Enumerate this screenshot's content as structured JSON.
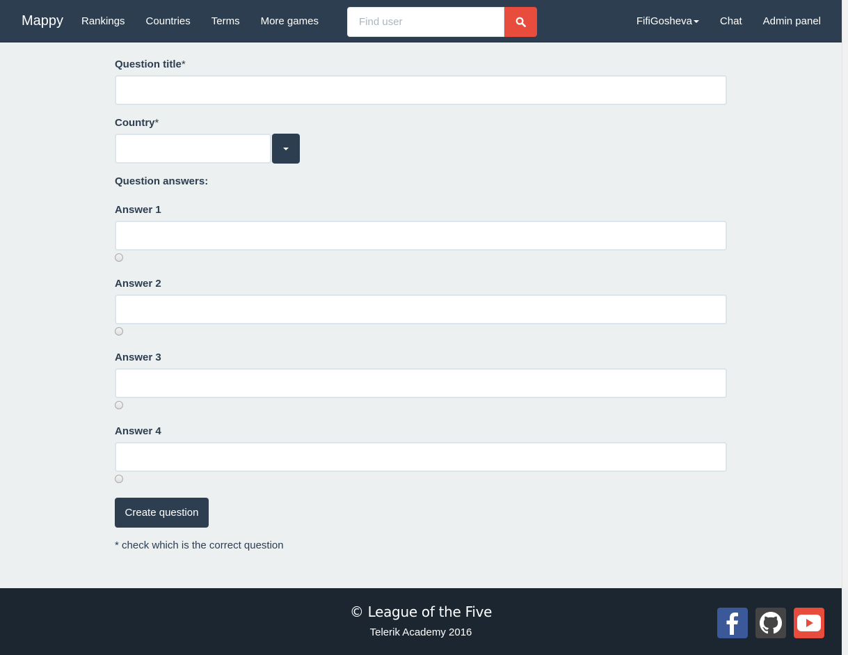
{
  "navbar": {
    "brand": "Mappy",
    "links": [
      "Rankings",
      "Countries",
      "Terms",
      "More games"
    ],
    "search_placeholder": "Find user",
    "user": "FifiGosheva",
    "chat": "Chat",
    "admin": "Admin panel"
  },
  "form": {
    "title_label": "Question title",
    "country_label": "Country",
    "required_mark": "*",
    "answers_heading": "Question answers:",
    "answers": [
      "Answer 1",
      "Answer 2",
      "Answer 3",
      "Answer 4"
    ],
    "submit_label": "Create question",
    "hint": "* check which is the correct question"
  },
  "footer": {
    "copyright": "© League of the Five",
    "academy": "Telerik Academy 2016",
    "social": [
      "facebook-icon",
      "github-icon",
      "youtube-icon"
    ]
  },
  "colors": {
    "primary": "#2c3e50",
    "danger": "#e74c3c",
    "background": "#ecf0f1",
    "footer": "#1b2631"
  }
}
